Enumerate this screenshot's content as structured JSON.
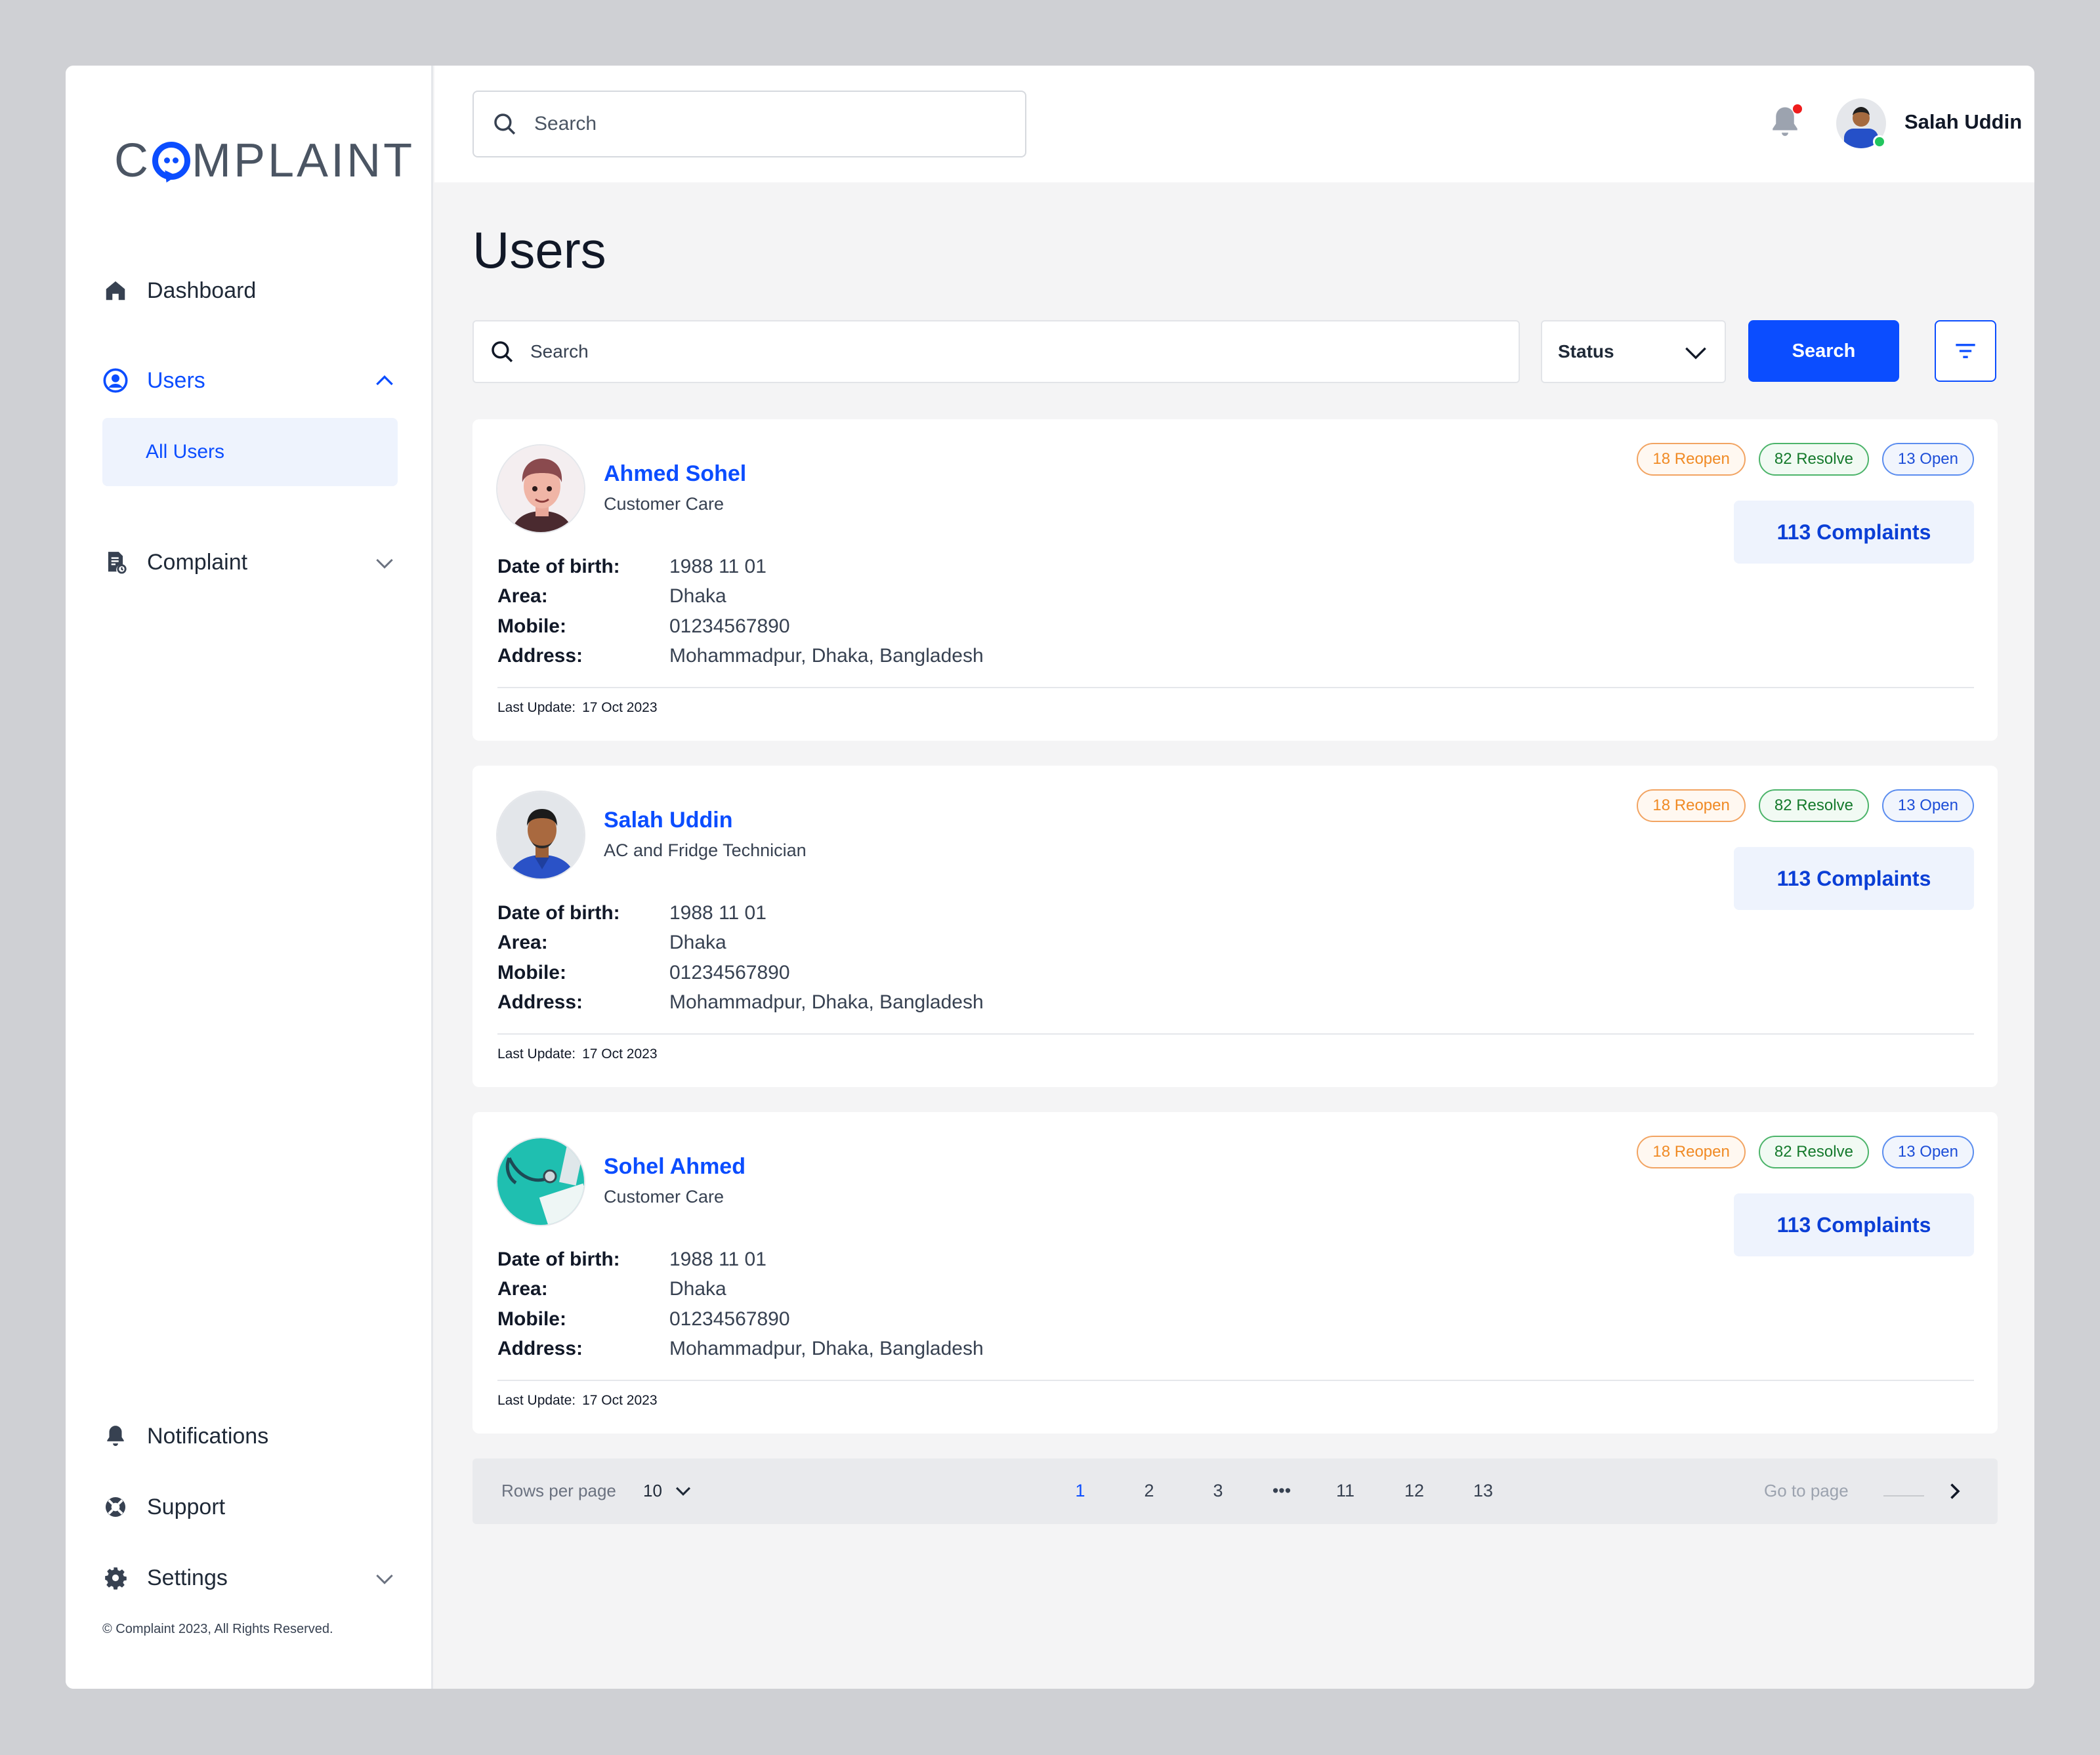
{
  "app": {
    "logo_prefix": "C",
    "logo_suffix": "MPLAINT",
    "accent": "#0b4dff"
  },
  "sidebar": {
    "items": [
      {
        "label": "Dashboard",
        "icon": "home-icon"
      },
      {
        "label": "Users",
        "icon": "user-circle-icon",
        "active": true,
        "expanded": true
      },
      {
        "label": "Complaint",
        "icon": "document-icon",
        "expanded": false
      }
    ],
    "subitems": [
      {
        "label": "All Users"
      }
    ],
    "bottom_items": [
      {
        "label": "Notifications",
        "icon": "bell-icon"
      },
      {
        "label": "Support",
        "icon": "lifebuoy-icon"
      },
      {
        "label": "Settings",
        "icon": "gear-icon"
      }
    ],
    "copyright": "© Complaint 2023, All Rights Reserved."
  },
  "topbar": {
    "search_placeholder": "Search",
    "user_name": "Salah Uddin",
    "has_notification": true
  },
  "main": {
    "title": "Users",
    "search_placeholder": "Search",
    "status_label": "Status",
    "search_button": "Search"
  },
  "users": [
    {
      "name": "Ahmed Sohel",
      "role": "Customer Care",
      "dob_label": "Date of birth:",
      "dob": "1988 11 01",
      "area_label": "Area:",
      "area": "Dhaka",
      "mobile_label": "Mobile:",
      "mobile": "01234567890",
      "address_label": "Address:",
      "address": "Mohammadpur, Dhaka, Bangladesh",
      "updated_label": "Last Update:",
      "updated": "17 Oct 2023",
      "reopen": "18 Reopen",
      "resolve": "82 Resolve",
      "open": "13 Open",
      "complaints": "113 Complaints"
    },
    {
      "name": "Salah Uddin",
      "role": "AC and Fridge Technician",
      "dob_label": "Date of birth:",
      "dob": "1988 11 01",
      "area_label": "Area:",
      "area": "Dhaka",
      "mobile_label": "Mobile:",
      "mobile": "01234567890",
      "address_label": "Address:",
      "address": "Mohammadpur, Dhaka, Bangladesh",
      "updated_label": "Last Update:",
      "updated": "17 Oct 2023",
      "reopen": "18 Reopen",
      "resolve": "82 Resolve",
      "open": "13 Open",
      "complaints": "113 Complaints"
    },
    {
      "name": "Sohel Ahmed",
      "role": "Customer Care",
      "dob_label": "Date of birth:",
      "dob": "1988 11 01",
      "area_label": "Area:",
      "area": "Dhaka",
      "mobile_label": "Mobile:",
      "mobile": "01234567890",
      "address_label": "Address:",
      "address": "Mohammadpur, Dhaka, Bangladesh",
      "updated_label": "Last Update:",
      "updated": "17 Oct 2023",
      "reopen": "18 Reopen",
      "resolve": "82 Resolve",
      "open": "13 Open",
      "complaints": "113 Complaints"
    }
  ],
  "pagination": {
    "rows_label": "Rows per page",
    "rows_value": "10",
    "pages": [
      "1",
      "2",
      "3",
      "•••",
      "11",
      "12",
      "13"
    ],
    "current": "1",
    "goto_label": "Go to page"
  }
}
